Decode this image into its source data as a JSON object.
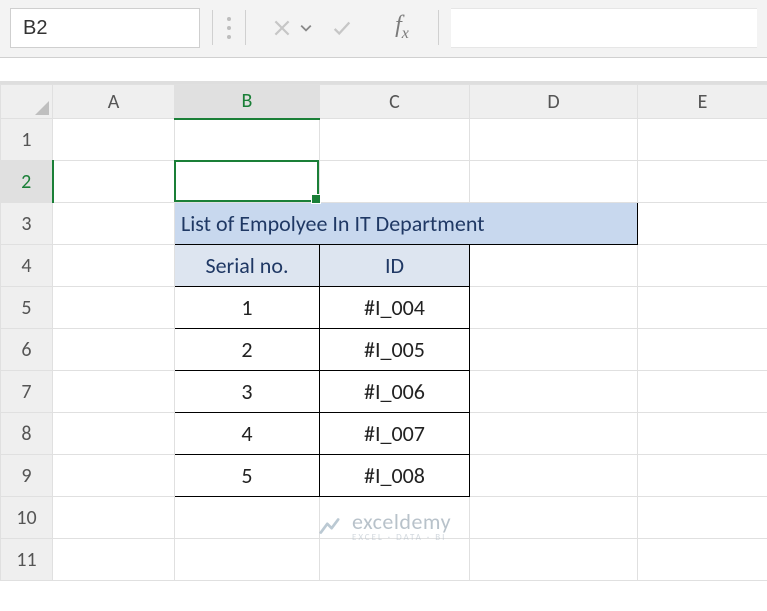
{
  "name_box": {
    "value": "B2"
  },
  "formula_bar": {
    "value": ""
  },
  "columns": [
    "A",
    "B",
    "C",
    "D",
    "E"
  ],
  "rows": [
    "1",
    "2",
    "3",
    "4",
    "5",
    "6",
    "7",
    "8",
    "9",
    "10",
    "11"
  ],
  "active": {
    "col": "B",
    "row": "2"
  },
  "data": {
    "title": "List of Empolyee In IT Department",
    "headers": {
      "serial": "Serial no.",
      "id": "ID"
    },
    "rows": [
      {
        "serial": "1",
        "id": "#I_004"
      },
      {
        "serial": "2",
        "id": "#I_005"
      },
      {
        "serial": "3",
        "id": "#I_006"
      },
      {
        "serial": "4",
        "id": "#I_007"
      },
      {
        "serial": "5",
        "id": "#I_008"
      }
    ]
  },
  "watermark": {
    "brand": "exceldemy",
    "tag": "EXCEL · DATA · BI"
  },
  "colors": {
    "selection": "#1a7f37",
    "title_bg": "#c8d8ee",
    "header_bg": "#dde5f0",
    "title_fg": "#1f3864"
  },
  "chart_data": {
    "type": "table",
    "title": "List of Empolyee In IT Department",
    "columns": [
      "Serial no.",
      "ID"
    ],
    "rows": [
      [
        "1",
        "#I_004"
      ],
      [
        "2",
        "#I_005"
      ],
      [
        "3",
        "#I_006"
      ],
      [
        "4",
        "#I_007"
      ],
      [
        "5",
        "#I_008"
      ]
    ]
  }
}
